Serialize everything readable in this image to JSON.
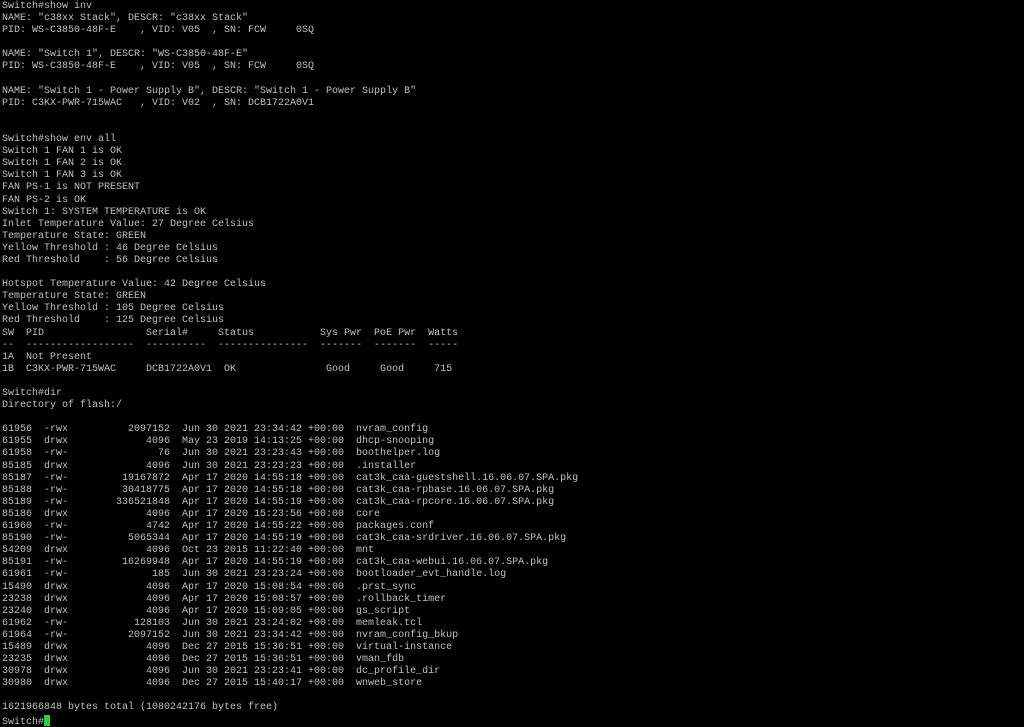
{
  "terminal": {
    "colors": {
      "background": "#000000",
      "text": "#c0c0c0",
      "cursor": "#2ecc40"
    },
    "lines": [
      "Switch#show inv",
      "NAME: \"c38xx Stack\", DESCR: \"c38xx Stack\"",
      "PID: WS-C3850-48F-E    , VID: V05  , SN: FCW     0SQ",
      "",
      "NAME: \"Switch 1\", DESCR: \"WS-C3850-48F-E\"",
      "PID: WS-C3850-48F-E    , VID: V05  , SN: FCW     0SQ",
      "",
      "NAME: \"Switch 1 - Power Supply B\", DESCR: \"Switch 1 - Power Supply B\"",
      "PID: C3KX-PWR-715WAC   , VID: V02  , SN: DCB1722A0V1",
      "",
      "",
      "Switch#show env all",
      "Switch 1 FAN 1 is OK",
      "Switch 1 FAN 2 is OK",
      "Switch 1 FAN 3 is OK",
      "FAN PS-1 is NOT PRESENT",
      "FAN PS-2 is OK",
      "Switch 1: SYSTEM TEMPERATURE is OK",
      "Inlet Temperature Value: 27 Degree Celsius",
      "Temperature State: GREEN",
      "Yellow Threshold : 46 Degree Celsius",
      "Red Threshold    : 56 Degree Celsius",
      "",
      "Hotspot Temperature Value: 42 Degree Celsius",
      "Temperature State: GREEN",
      "Yellow Threshold : 105 Degree Celsius",
      "Red Threshold    : 125 Degree Celsius",
      "SW  PID                 Serial#     Status           Sys Pwr  PoE Pwr  Watts",
      "--  ------------------  ----------  ---------------  -------  -------  -----",
      "1A  Not Present",
      "1B  C3KX-PWR-715WAC     DCB1722A0V1  OK               Good     Good     715",
      "",
      "Switch#dir",
      "Directory of flash:/",
      "",
      "61956  -rwx          2097152  Jun 30 2021 23:34:42 +00:00  nvram_config",
      "61955  drwx             4096  May 23 2019 14:13:25 +00:00  dhcp-snooping",
      "61958  -rw-               76  Jun 30 2021 23:23:43 +00:00  boothelper.log",
      "85185  drwx             4096  Jun 30 2021 23:23:23 +00:00  .installer",
      "85187  -rw-         19167872  Apr 17 2020 14:55:18 +00:00  cat3k_caa-guestshell.16.06.07.SPA.pkg",
      "85188  -rw-         30418775  Apr 17 2020 14:55:18 +00:00  cat3k_caa-rpbase.16.06.07.SPA.pkg",
      "85189  -rw-        336521848  Apr 17 2020 14:55:19 +00:00  cat3k_caa-rpcore.16.06.07.SPA.pkg",
      "85186  drwx             4096  Apr 17 2020 15:23:56 +00:00  core",
      "61960  -rw-             4742  Apr 17 2020 14:55:22 +00:00  packages.conf",
      "85190  -rw-          5065344  Apr 17 2020 14:55:19 +00:00  cat3k_caa-srdriver.16.06.07.SPA.pkg",
      "54209  drwx             4096  Oct 23 2015 11:22:40 +00:00  mnt",
      "85191  -rw-         16269948  Apr 17 2020 14:55:19 +00:00  cat3k_caa-webui.16.06.07.SPA.pkg",
      "61961  -rw-              185  Jun 30 2021 23:23:24 +00:00  bootloader_evt_handle.log",
      "15490  drwx             4096  Apr 17 2020 15:08:54 +00:00  .prst_sync",
      "23238  drwx             4096  Apr 17 2020 15:08:57 +00:00  .rollback_timer",
      "23240  drwx             4096  Apr 17 2020 15:09:05 +00:00  gs_script",
      "61962  -rw-           128103  Jun 30 2021 23:24:02 +00:00  memleak.tcl",
      "61964  -rw-          2097152  Jun 30 2021 23:34:42 +00:00  nvram_config_bkup",
      "15489  drwx             4096  Dec 27 2015 15:36:51 +00:00  virtual-instance",
      "23235  drwx             4096  Dec 27 2015 15:36:51 +00:00  vman_fdb",
      "30978  drwx             4096  Jun 30 2021 23:23:41 +00:00  dc_profile_dir",
      "30980  drwx             4096  Dec 27 2015 15:40:17 +00:00  wnweb_store",
      "",
      "1621966848 bytes total (1080242176 bytes free)"
    ],
    "prompt": "Switch#"
  }
}
